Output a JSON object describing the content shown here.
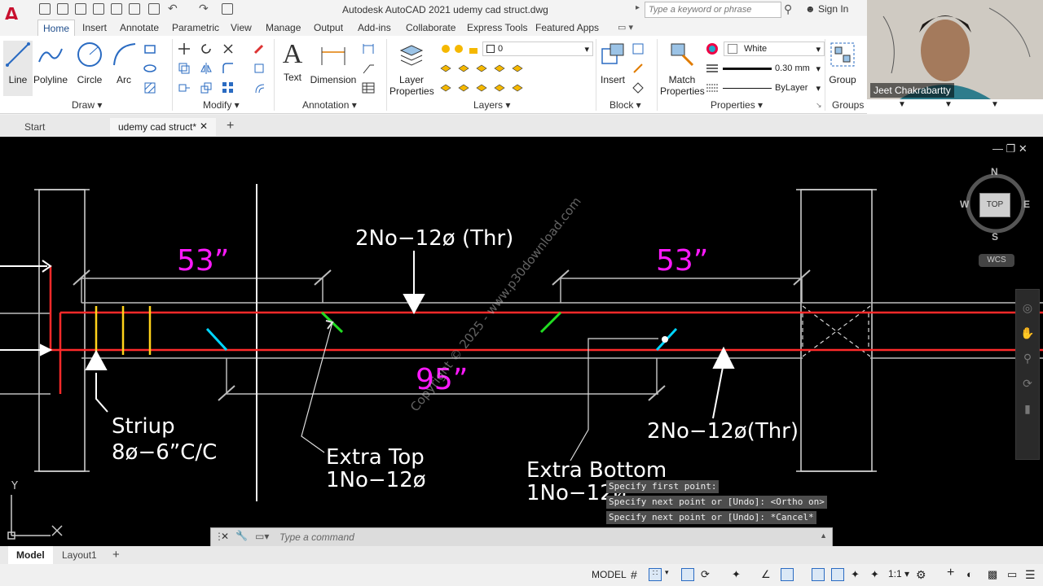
{
  "app": {
    "logo": "A",
    "title": "Autodesk AutoCAD 2021    udemy cad struct.dwg",
    "search_placeholder": "Type a keyword or phrase",
    "signin": "Sign In"
  },
  "ribbon_tabs": [
    "Home",
    "Insert",
    "Annotate",
    "Parametric",
    "View",
    "Manage",
    "Output",
    "Add-ins",
    "Collaborate",
    "Express Tools",
    "Featured Apps"
  ],
  "ribbon": {
    "draw": {
      "label": "Draw",
      "tools": [
        "Line",
        "Polyline",
        "Circle",
        "Arc"
      ]
    },
    "modify": {
      "label": "Modify"
    },
    "annotation": {
      "label": "Annotation",
      "tools": [
        "Text",
        "Dimension"
      ]
    },
    "layers": {
      "label": "Layers",
      "layer_props": "Layer Properties",
      "current_layer": "0"
    },
    "block": {
      "label": "Block",
      "insert": "Insert"
    },
    "properties": {
      "label": "Properties",
      "match": "Match Properties",
      "color": "White",
      "lineweight": "0.30 mm",
      "linetype": "ByLayer"
    },
    "groups": {
      "label": "Groups",
      "group": "Group"
    }
  },
  "file_tabs": {
    "start": "Start",
    "active": "udemy cad struct*"
  },
  "drawing": {
    "dim_left": "53”",
    "dim_right": "53”",
    "dim_bottom": "95”",
    "label_top": "2No−12ø (Thr)",
    "label_right": "2No−12ø(Thr)",
    "stirrup_line1": "Striup",
    "stirrup_line2": "8ø−6”C/C",
    "extra_top_1": "Extra Top",
    "extra_top_2": "1No−12ø",
    "extra_bottom_1": "Extra Bottom",
    "extra_bottom_2": "1No−12ø",
    "watermark": "Copyright © 2025 - www.p30download.com",
    "ucs_y": "Y",
    "ucs_x": "X"
  },
  "viewcube": {
    "n": "N",
    "s": "S",
    "e": "E",
    "w": "W",
    "top": "TOP",
    "wcs": "WCS"
  },
  "command": {
    "history": [
      "Specify first point:",
      "Specify next point or [Undo]:  <Ortho on>",
      "Specify next point or [Undo]: *Cancel*"
    ],
    "placeholder": "Type a command"
  },
  "layout_tabs": [
    "Model",
    "Layout1"
  ],
  "status": {
    "model": "MODEL",
    "scale": "1:1"
  },
  "webcam": {
    "name": "Jeet Chakrabartty"
  },
  "colors": {
    "rebar_red": "#ff2a2a",
    "dimension_magenta": "#ff19ff",
    "stirrup_yellow": "#ffd21a",
    "cyan": "#00d5ff",
    "green": "#22dd22",
    "canvas": "#000000"
  }
}
